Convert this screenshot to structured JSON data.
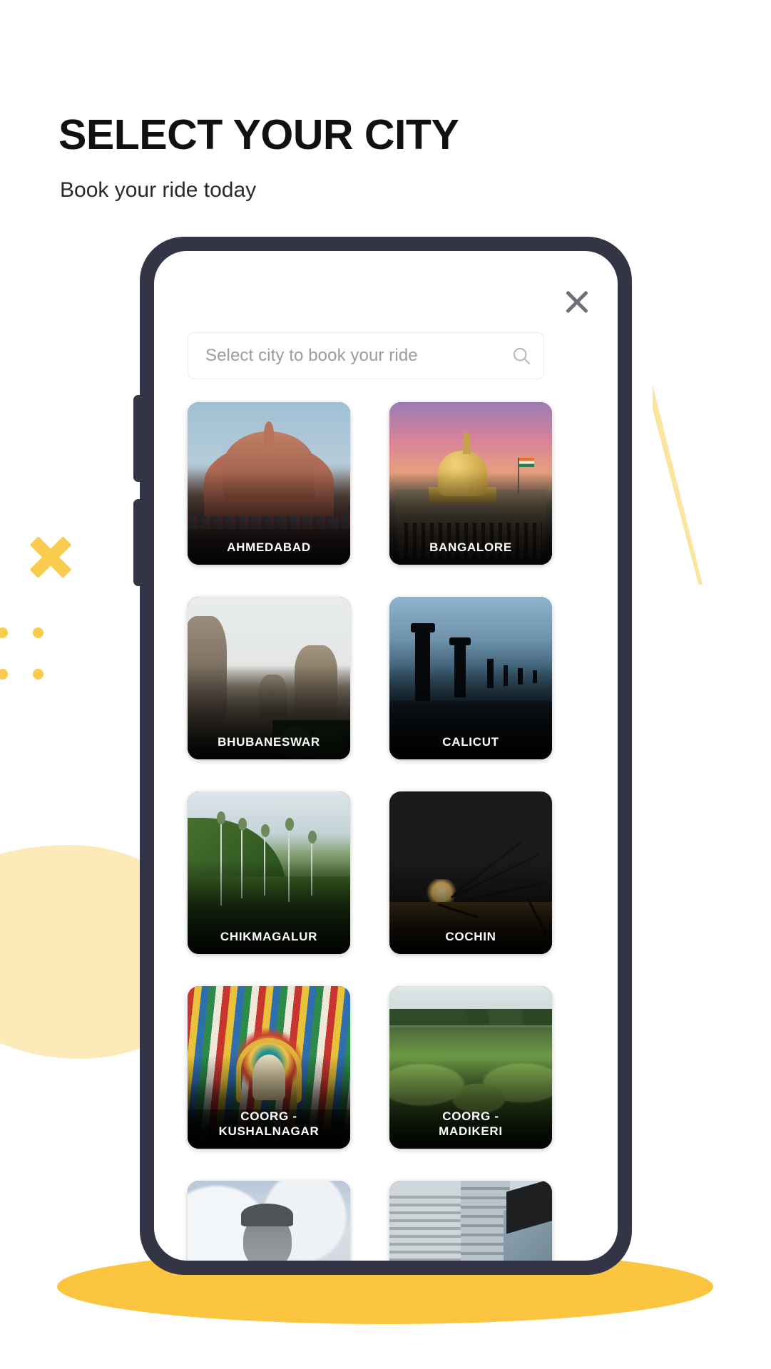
{
  "header": {
    "title": "SELECT YOUR CITY",
    "subtitle": "Book your ride today"
  },
  "modal": {
    "close_icon": "close-icon"
  },
  "search": {
    "value": "",
    "placeholder": "Select city to book your ride",
    "icon": "search-icon"
  },
  "cities": [
    {
      "label": "AHMEDABAD",
      "art": "art-ahmedabad"
    },
    {
      "label": "BANGALORE",
      "art": "art-bangalore"
    },
    {
      "label": "BHUBANESWAR",
      "art": "art-bhubaneswar"
    },
    {
      "label": "CALICUT",
      "art": "art-calicut"
    },
    {
      "label": "CHIKMAGALUR",
      "art": "art-chikmagalur"
    },
    {
      "label": "COCHIN",
      "art": "art-cochin"
    },
    {
      "label": "COORG -\nKUSHALNAGAR",
      "art": "art-kushalnagar"
    },
    {
      "label": "COORG -\nMADIKERI",
      "art": "art-madikeri"
    },
    {
      "label": "",
      "art": "art-buddha"
    },
    {
      "label": "",
      "art": "art-office"
    }
  ],
  "decorations": {
    "x_mark": "x-decoration",
    "dots": 4,
    "colors": {
      "accent_yellow": "#F9CC4E",
      "ellipse_yellow": "#FBC53F",
      "pale_yellow": "#FCEBB8",
      "sliver_yellow": "#FBE3A0",
      "phone_frame": "#343447",
      "title_text": "#111114"
    }
  }
}
